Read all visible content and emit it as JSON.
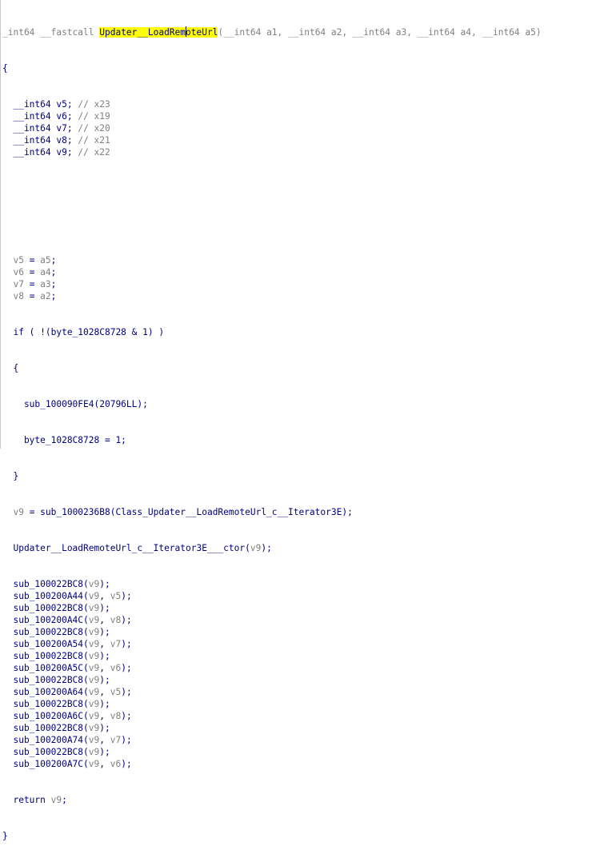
{
  "editor": {
    "header": {
      "pre": "_int64 __fastcall ",
      "func_a": "Updater__LoadRem",
      "func_b": "oteUrl",
      "params": "(__int64 a1, __int64 a2, __int64 a3, __int64 a4, __int64 a5)"
    },
    "open_brace": "{",
    "close_brace": "}",
    "decls": [
      {
        "type": "  __int64 ",
        "name": "v5",
        "sep": "; ",
        "comment": "// x23"
      },
      {
        "type": "  __int64 ",
        "name": "v6",
        "sep": "; ",
        "comment": "// x19"
      },
      {
        "type": "  __int64 ",
        "name": "v7",
        "sep": "; ",
        "comment": "// x20"
      },
      {
        "type": "  __int64 ",
        "name": "v8",
        "sep": "; ",
        "comment": "// x21"
      },
      {
        "type": "  __int64 ",
        "name": "v9",
        "sep": "; ",
        "comment": "// x22"
      }
    ],
    "assigns": [
      {
        "lhs": "  v5",
        "op": " = ",
        "rhs": "a5",
        "end": ";"
      },
      {
        "lhs": "  v6",
        "op": " = ",
        "rhs": "a4",
        "end": ";"
      },
      {
        "lhs": "  v7",
        "op": " = ",
        "rhs": "a3",
        "end": ";"
      },
      {
        "lhs": "  v8",
        "op": " = ",
        "rhs": "a2",
        "end": ";"
      }
    ],
    "if_line": "  if ( !(byte_1028C8728 & 1) )",
    "inner_open": "  {",
    "inner_1": "    sub_100090FE4(20796LL);",
    "inner_2": "    byte_1028C8728 = 1;",
    "inner_close": "  }",
    "v9_assign": {
      "lhs": "  v9",
      "rest": " = sub_1000236B8(Class_Updater__LoadRemoteUrl_c__Iterator3E);"
    },
    "ctor_line": {
      "pre": "  Updater__LoadRemoteUrl_c__Iterator3E___ctor(",
      "arg": "v9",
      "post": ");"
    },
    "calls": [
      {
        "fn": "  sub_100022BC8(",
        "a1": "v9",
        "mid": "",
        "a2": "",
        "end": ");"
      },
      {
        "fn": "  sub_100200A44(",
        "a1": "v9",
        "mid": ", ",
        "a2": "v5",
        "end": ");"
      },
      {
        "fn": "  sub_100022BC8(",
        "a1": "v9",
        "mid": "",
        "a2": "",
        "end": ");"
      },
      {
        "fn": "  sub_100200A4C(",
        "a1": "v9",
        "mid": ", ",
        "a2": "v8",
        "end": ");"
      },
      {
        "fn": "  sub_100022BC8(",
        "a1": "v9",
        "mid": "",
        "a2": "",
        "end": ");"
      },
      {
        "fn": "  sub_100200A54(",
        "a1": "v9",
        "mid": ", ",
        "a2": "v7",
        "end": ");"
      },
      {
        "fn": "  sub_100022BC8(",
        "a1": "v9",
        "mid": "",
        "a2": "",
        "end": ");"
      },
      {
        "fn": "  sub_100200A5C(",
        "a1": "v9",
        "mid": ", ",
        "a2": "v6",
        "end": ");"
      },
      {
        "fn": "  sub_100022BC8(",
        "a1": "v9",
        "mid": "",
        "a2": "",
        "end": ");"
      },
      {
        "fn": "  sub_100200A64(",
        "a1": "v9",
        "mid": ", ",
        "a2": "v5",
        "end": ");"
      },
      {
        "fn": "  sub_100022BC8(",
        "a1": "v9",
        "mid": "",
        "a2": "",
        "end": ");"
      },
      {
        "fn": "  sub_100200A6C(",
        "a1": "v9",
        "mid": ", ",
        "a2": "v8",
        "end": ");"
      },
      {
        "fn": "  sub_100022BC8(",
        "a1": "v9",
        "mid": "",
        "a2": "",
        "end": ");"
      },
      {
        "fn": "  sub_100200A74(",
        "a1": "v9",
        "mid": ", ",
        "a2": "v7",
        "end": ");"
      },
      {
        "fn": "  sub_100022BC8(",
        "a1": "v9",
        "mid": "",
        "a2": "",
        "end": ");"
      },
      {
        "fn": "  sub_100200A7C(",
        "a1": "v9",
        "mid": ", ",
        "a2": "v6",
        "end": ");"
      }
    ],
    "return_line": {
      "kw": "  return ",
      "val": "v9",
      "end": ";"
    }
  },
  "colors": {
    "keyword": "#000080",
    "variable": "#808080",
    "highlight": "#ffff00",
    "background": "#ffffff"
  }
}
